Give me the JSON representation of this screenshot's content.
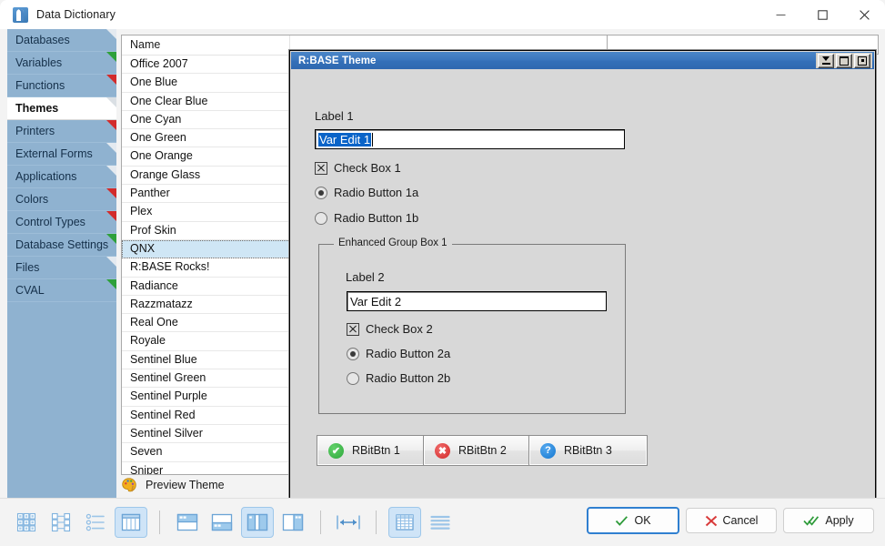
{
  "window": {
    "title": "Data Dictionary",
    "app_icon": "rbase-logo-icon",
    "minimize_label": "—",
    "maximize_label": "□",
    "close_label": "✕"
  },
  "sidebar": {
    "items": [
      {
        "label": "Databases",
        "marker": "gray",
        "selected": false
      },
      {
        "label": "Variables",
        "marker": "green",
        "selected": false
      },
      {
        "label": "Functions",
        "marker": "red",
        "selected": false
      },
      {
        "label": "Themes",
        "marker": "faint",
        "selected": true
      },
      {
        "label": "Printers",
        "marker": "red",
        "selected": false
      },
      {
        "label": "External Forms",
        "marker": "gray",
        "selected": false
      },
      {
        "label": "Applications",
        "marker": "gray",
        "selected": false
      },
      {
        "label": "Colors",
        "marker": "red",
        "selected": false
      },
      {
        "label": "Control Types",
        "marker": "red",
        "selected": false
      },
      {
        "label": "Database Settings",
        "marker": "green",
        "selected": false
      },
      {
        "label": "Files",
        "marker": "gray",
        "selected": false
      },
      {
        "label": "CVAL",
        "marker": "green",
        "selected": false
      }
    ]
  },
  "theme_list": {
    "header": "Name",
    "selected": "QNX",
    "rows": [
      "Office 2007",
      "One Blue",
      "One Clear Blue",
      "One Cyan",
      "One Green",
      "One Orange",
      "Orange Glass",
      "Panther",
      "Plex",
      "Prof Skin",
      "QNX",
      "R:BASE Rocks!",
      "Radiance",
      "Razzmatazz",
      "Real One",
      "Royale",
      "Sentinel Blue",
      "Sentinel Green",
      "Sentinel Purple",
      "Sentinel Red",
      "Sentinel Silver",
      "Seven",
      "Sniper"
    ]
  },
  "preview": {
    "label": "Preview Theme",
    "icon": "palette-icon"
  },
  "dialog": {
    "title": "R:BASE Theme",
    "titlebar_buttons": [
      {
        "name": "minimize-icon"
      },
      {
        "name": "maximize-icon"
      },
      {
        "name": "restore-icon"
      }
    ],
    "label1": "Label 1",
    "edit1_value": "Var Edit 1",
    "checkbox1": {
      "label": "Check Box 1",
      "checked": true
    },
    "radio1a": {
      "label": "Radio Button 1a",
      "checked": true
    },
    "radio1b": {
      "label": "Radio Button 1b",
      "checked": false
    },
    "groupbox": {
      "title": "Enhanced Group Box 1",
      "label2": "Label 2",
      "edit2_value": "Var Edit 2",
      "checkbox2": {
        "label": "Check Box 2",
        "checked": true
      },
      "radio2a": {
        "label": "Radio Button 2a",
        "checked": true
      },
      "radio2b": {
        "label": "Radio Button 2b",
        "checked": false
      }
    },
    "bit_buttons": [
      {
        "label": "RBitBtn 1",
        "icon": "check-circle-icon",
        "color": "#2fa83c",
        "glyph": "✔"
      },
      {
        "label": "RBitBtn 2",
        "icon": "cross-circle-icon",
        "color": "#d32b2b",
        "glyph": "✖"
      },
      {
        "label": "RBitBtn 3",
        "icon": "question-circle-icon",
        "color": "#1478d0",
        "glyph": "?"
      }
    ]
  },
  "toolbar": {
    "buttons": [
      {
        "name": "grid-cards-view-icon",
        "active": false
      },
      {
        "name": "tree-view-icon",
        "active": false
      },
      {
        "name": "bullet-list-view-icon",
        "active": false
      },
      {
        "name": "table-columns-view-icon",
        "active": true
      },
      {
        "name": "layout-top-panel-icon",
        "active": false
      },
      {
        "name": "layout-bottom-panel-icon",
        "active": false
      },
      {
        "name": "layout-left-panel-icon",
        "active": true
      },
      {
        "name": "layout-right-panel-icon",
        "active": false
      },
      {
        "name": "fit-width-icon",
        "active": false
      },
      {
        "name": "grid-lines-icon",
        "active": true
      },
      {
        "name": "row-lines-icon",
        "active": false
      }
    ]
  },
  "footer_buttons": {
    "ok": "OK",
    "cancel": "Cancel",
    "apply": "Apply"
  }
}
